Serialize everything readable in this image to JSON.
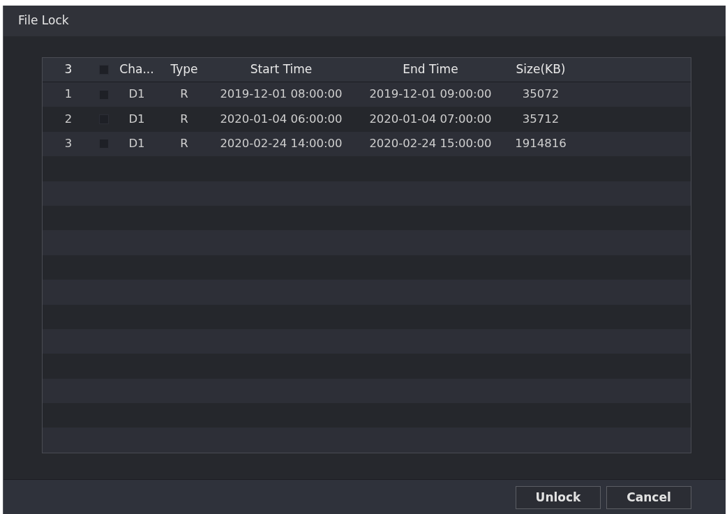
{
  "window": {
    "title": "File Lock"
  },
  "table": {
    "header": {
      "count": "3",
      "checked": false,
      "columns": [
        "Cha...",
        "Type",
        "Start Time",
        "End Time",
        "Size(KB)"
      ]
    },
    "rows": [
      {
        "index": "1",
        "checked": false,
        "channel": "D1",
        "type": "R",
        "start_time": "2019-12-01 08:00:00",
        "end_time": "2019-12-01 09:00:00",
        "size": "35072"
      },
      {
        "index": "2",
        "checked": false,
        "channel": "D1",
        "type": "R",
        "start_time": "2020-01-04 06:00:00",
        "end_time": "2020-01-04 07:00:00",
        "size": "35712"
      },
      {
        "index": "3",
        "checked": false,
        "channel": "D1",
        "type": "R",
        "start_time": "2020-02-24 14:00:00",
        "end_time": "2020-02-24 15:00:00",
        "size": "1914816"
      }
    ]
  },
  "buttons": [
    {
      "label": "Unlock"
    },
    {
      "label": "Cancel"
    }
  ]
}
